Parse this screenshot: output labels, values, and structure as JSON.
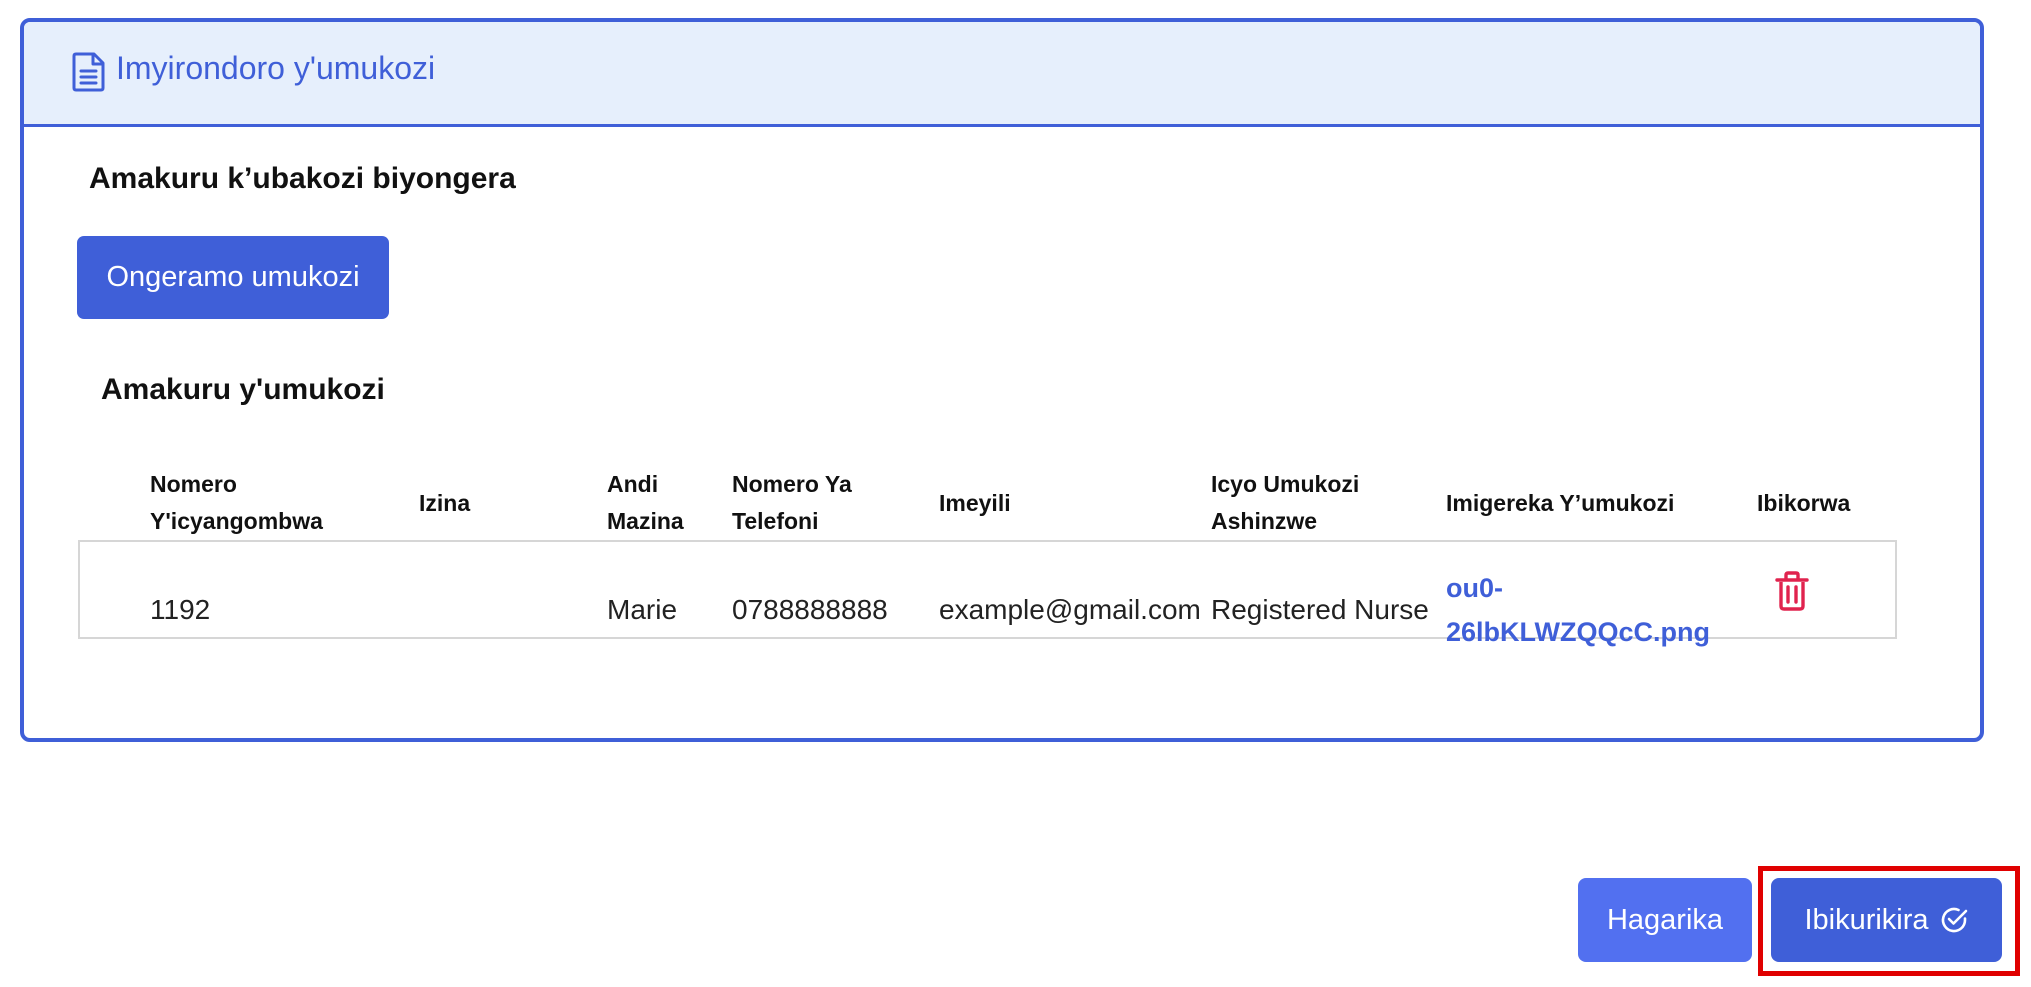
{
  "card": {
    "title": "Imyirondoro y'umukozi",
    "icon": "document-icon"
  },
  "section_add": {
    "heading": "Amakuru k’ubakozi biyongera",
    "add_button_label": "Ongeramo umukozi"
  },
  "section_list": {
    "heading": "Amakuru y'umukozi",
    "columns": [
      {
        "line1": "Nomero",
        "line2": "Y'icyangombwa"
      },
      {
        "line1": "Izina",
        "line2": ""
      },
      {
        "line1": "Andi",
        "line2": "Mazina"
      },
      {
        "line1": "Nomero Ya",
        "line2": "Telefoni"
      },
      {
        "line1": "Imeyili",
        "line2": ""
      },
      {
        "line1": "Icyo Umukozi",
        "line2": "Ashinzwe"
      },
      {
        "line1": "Imigereka Y’umukozi",
        "line2": ""
      },
      {
        "line1": "Ibikorwa",
        "line2": ""
      }
    ],
    "rows": [
      {
        "id_number": "1192",
        "first_name": "",
        "other_names": "Marie",
        "phone": "0788888888",
        "email": "example@gmail.com",
        "role": "Registered Nurse",
        "attachment_line1": "ou0-",
        "attachment_line2": "26lbKLWZQQcC.png",
        "action_icon": "trash-icon"
      }
    ]
  },
  "footer": {
    "cancel_label": "Hagarika",
    "submit_label": "Ibikurikira",
    "submit_icon": "check-circle-icon"
  },
  "colors": {
    "primary": "#3f5fd8",
    "cancel": "#5270f0",
    "header_bg": "#e6effc",
    "danger": "#e0234e",
    "highlight": "#e00000"
  }
}
